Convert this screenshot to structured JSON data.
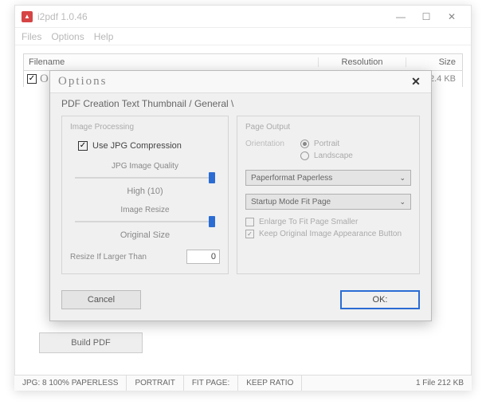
{
  "app": {
    "title": "i2pdf 1.0.46"
  },
  "menu": {
    "files": "Files",
    "options": "Options",
    "help": "Help"
  },
  "table": {
    "headers": {
      "filename": "Filename",
      "resolution": "Resolution",
      "size": "Size"
    },
    "row": {
      "filename": "Options",
      "size": "212.4 KB"
    }
  },
  "buildBtn": "Build PDF",
  "status": {
    "jpg": "JPG: 8 100% PAPERLESS",
    "orient": "PORTRAIT",
    "fit": "FIT PAGE:",
    "keep": "KEEP RATIO",
    "files": "1 File 212 KB"
  },
  "dialog": {
    "title": "Options",
    "tabs": "PDF Creation Text Thumbnail / General \\",
    "groupImage": {
      "title": "Image Processing",
      "useJpg": "Use JPG Compression",
      "qualityLabel": "JPG Image Quality",
      "qualityValue": "High (10)",
      "resizeLabel": "Image Resize",
      "resizeValue": "Original Size",
      "resizeIf": "Resize If Larger Than",
      "resizeInput": "0"
    },
    "groupPage": {
      "title": "Page Output",
      "orientLabel": "Orientation",
      "portrait": "Portrait",
      "landscape": "Landscape",
      "paperLabel": "Paperformat",
      "paperValue": "Paperless",
      "startupLabel": "Startup Mode",
      "startupValue": "Fit Page",
      "enlarge": "Enlarge To Fit Page Smaller",
      "keep": "Keep Original Image Appearance Button"
    },
    "cancel": "Cancel",
    "ok": "OK:"
  }
}
